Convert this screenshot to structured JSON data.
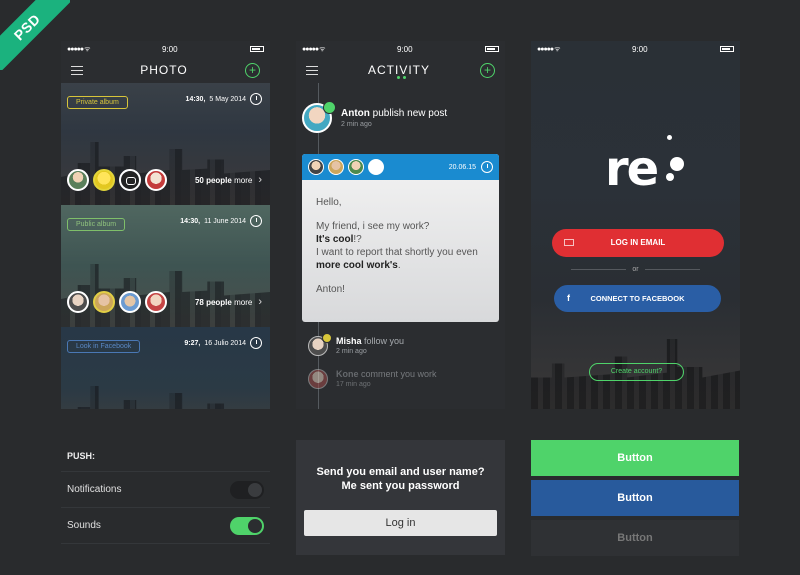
{
  "ribbon": {
    "label": "PSD"
  },
  "status": {
    "time": "9:00"
  },
  "photo_screen": {
    "title": "PHOTO",
    "albums": [
      {
        "tag": "Private album",
        "date_bold": "14:30,",
        "date": "5 May 2014",
        "count_bold": "50 people",
        "count_suffix": "more"
      },
      {
        "tag": "Public album",
        "date_bold": "14:30,",
        "date": "11 June 2014",
        "count_bold": "78 people",
        "count_suffix": "more"
      },
      {
        "tag": "Look in Facebook",
        "date_bold": "9:27,",
        "date": "16 Julio 2014"
      }
    ]
  },
  "push_settings": {
    "header": "PUSH:",
    "rows": [
      {
        "label": "Notifications",
        "state": "off"
      },
      {
        "label": "Sounds",
        "state": "on"
      }
    ]
  },
  "activity_screen": {
    "title": "ACTIVITY",
    "post": {
      "name": "Anton",
      "action": "publish new post",
      "ago": "2 min ago"
    },
    "card": {
      "date": "20.06.15",
      "greeting": "Hello,",
      "body_1": "My friend, i see my work?",
      "body_2_bold": "It's cool",
      "body_2_rest": "!?",
      "body_3": "I want to report that shortly you even",
      "body_3_bold": "more cool work's",
      "body_3_end": ".",
      "sign": "Anton!"
    },
    "follow": {
      "name": "Misha",
      "action": "follow you",
      "ago": "2 min ago"
    },
    "comment": {
      "name": "Kone",
      "action": "comment you work",
      "ago": "17 min ago"
    }
  },
  "login_prompt": {
    "message_line1": "Send you email and user name?",
    "message_line2": "Me sent you password",
    "button": "Log in"
  },
  "welcome_screen": {
    "logo": "re",
    "login_email": "LOG IN EMAIL",
    "or": "or",
    "connect_facebook": "CONNECT TO FACEBOOK",
    "create_account": "Create account?"
  },
  "button_styles": [
    "Button",
    "Button",
    "Button"
  ],
  "colors": {
    "accent_green": "#4fd36a",
    "accent_red": "#e02f33",
    "accent_blue": "#2a5ea5",
    "card_blue": "#1a8bd0",
    "background": "#292b2d"
  }
}
